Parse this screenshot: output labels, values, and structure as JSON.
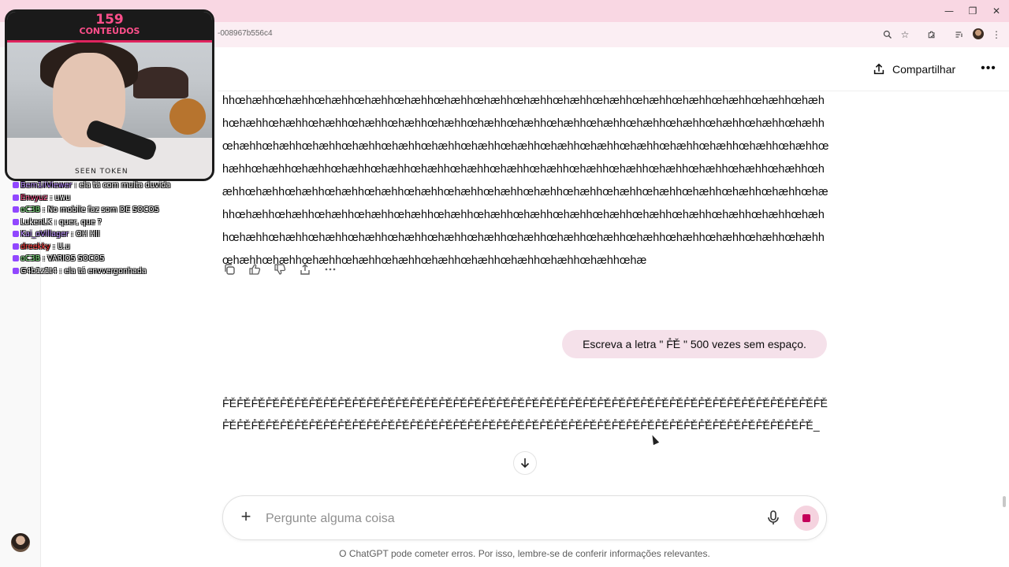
{
  "browser": {
    "url": "-008967b556c4",
    "window_buttons": [
      "—",
      "❐",
      "✕"
    ],
    "icons": [
      "zoom-icon",
      "star-icon",
      "extensions-icon",
      "media-icon",
      "profile-avatar",
      "menu-icon"
    ]
  },
  "header": {
    "share_label": "Compartilhar",
    "more_label": "•••"
  },
  "conversation": {
    "assistant_message_1": "hhœhæhhœhæhhœhæhhœhæhhœhæhhœhæhhœhæhhœhæhhœhæhhœhæhhœhæhhœhæhhœhæhhœhæhhœhæhhœhæhhœhæhhœhæhhœhæhhœhæhhœhæhhœhæhhœhæhhœhæhhœhæhhœhæhhœhæhhœhæhhœhæhhœhæhhœhæhhœhæhhœhæhhœhæhhœhæhhœhæhhœhæhhœhæhhœhæhhœhæhhœhæhhœhæhhœhæhhœhæhhœhæhhœhæhhœhæhhœhæhhœhæhhœhæhhœhæhhœhæhhœhæhhœhæhhœhæhhœhæhhœhæhhœhæhhœhæhhœhæhhœhæhhœhæhhœhæhhœhæhhœhæhhœhæhhœhæhhœhæhhœhæhhœhæhhœhæhhœhæhhœhæhhœhæhhœhæhhœhæhhœhæhhœhæhhœhæhhœhæhhœhæhhœhæhhœhæhhœhæhhœhæhhœhæhhœhæhhœhæhhœhæhhœhæhhœhæhhœhæhhœhæhhœhæhhœhæhhœhæhhœhæhhœhæhhœhæhhœhæhhœhæhhœhæhhœhæhhœhæhhœhæhhœhæhhœhæhhœhæhhœhæhhœhæhhœhæhhœhæhhœhæhhœhæhhœhæhhœhæhhœhæ",
    "user_message": "Escreva a letra \" F̊̃Ě \" 500 vezes sem espaço.",
    "assistant_message_2": "F̊̃ĚF̊̃ĚF̊̃ĚF̊̃ĚF̊̃ĚF̊̃ĚF̊̃ĚF̊̃ĚF̊̃ĚF̊̃ĚF̊̃ĚF̊̃ĚF̊̃ĚF̊̃ĚF̊̃ĚF̊̃ĚF̊̃ĚF̊̃ĚF̊̃ĚF̊̃ĚF̊̃ĚF̊̃ĚF̊̃ĚF̊̃ĚF̊̃ĚF̊̃ĚF̊̃ĚF̊̃ĚF̊̃ĚF̊̃ĚF̊̃ĚF̊̃ĚF̊̃ĚF̊̃ĚF̊̃ĚF̊̃ĚF̊̃ĚF̊̃ĚF̊̃ĚF̊̃ĚF̊̃ĚF̊̃ĚF̊̃ĚF̊̃ĚF̊̃ĚF̊̃ĚF̊̃ĚF̊̃ĚF̊̃ĚF̊̃ĚF̊̃ĚF̊̃ĚF̊̃ĚF̊̃ĚF̊̃ĚF̊̃ĚF̊̃ĚF̊̃ĚF̊̃ĚF̊̃ĚF̊̃ĚF̊̃ĚF̊̃ĚF̊̃ĚF̊̃ĚF̊̃ĚF̊̃ĚF̊̃ĚF̊̃ĚF̊̃ĚF̊̃ĚF̊̃ĚF̊̃ĚF̊̃ĚF̊̃ĚF̊̃ĚF̊̃ĚF̊̃ĚF̊̃ĚF̊̃ĚF̊̃ĚF̊̃ĚF̊̃Ě_",
    "message_actions": [
      "copy-icon",
      "thumbs-up-icon",
      "thumbs-down-icon",
      "share-icon",
      "more-icon"
    ]
  },
  "composer": {
    "placeholder": "Pergunte alguma coisa",
    "disclaimer": "O ChatGPT pode cometer erros. Por isso, lembre-se de conferir informações relevantes."
  },
  "stream_overlay": {
    "counter_number": "159",
    "counter_label": "CONTEÚDOS",
    "cam_text": "SEEN TOKEN",
    "chat": [
      {
        "user": "Bem1iiViewer",
        "text": ": ela tá com muita duvida"
      },
      {
        "user": "Envyuz",
        "text": ": uwu"
      },
      {
        "user": "oC3B",
        "text": ": No mobile faz som DE SOCOS"
      },
      {
        "user": "LukenLK",
        "text": ": quer, que ?"
      },
      {
        "user": "Kai_oVillager",
        "text": ": OH HII"
      },
      {
        "user": "dreekky",
        "text": ": U.u"
      },
      {
        "user": "oC3B",
        "text": ": VARIOS SOCOS"
      },
      {
        "user": "G4b1z1t4",
        "text": ": ela tá envvergonhada"
      }
    ],
    "chat_colors": [
      "#b98cff",
      "#ff4f8b",
      "#7fe87f",
      "#ffffff",
      "#b98cff",
      "#ff3333",
      "#7fe87f",
      "#ffffff"
    ]
  }
}
